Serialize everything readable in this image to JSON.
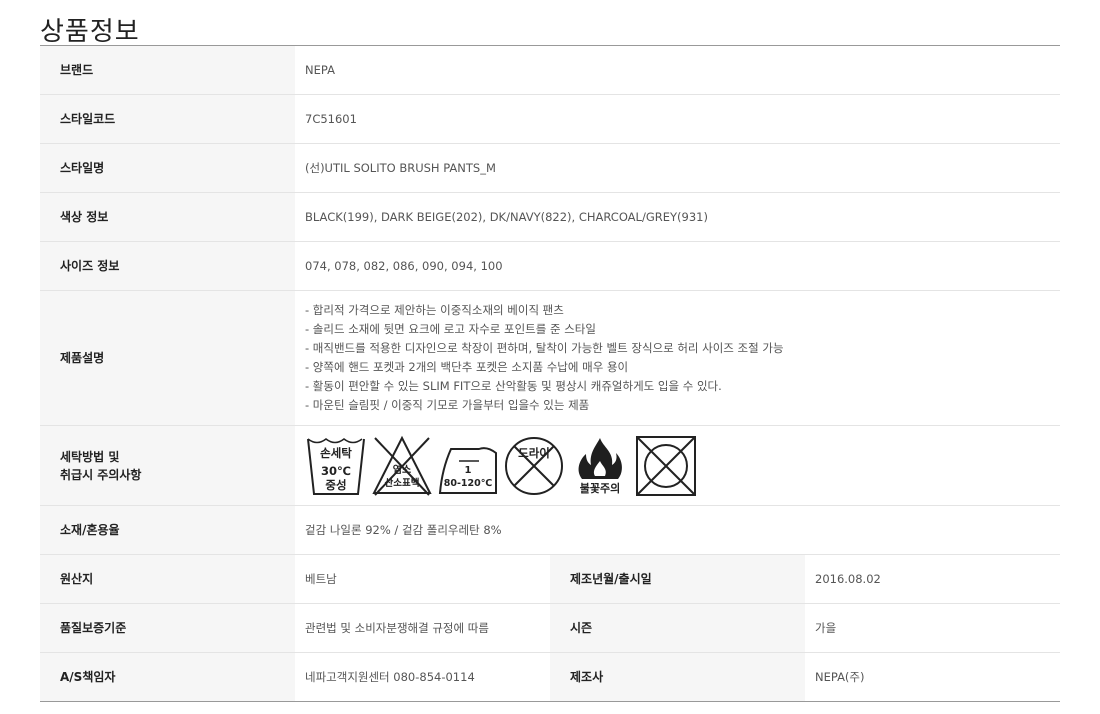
{
  "page": {
    "title": "상품정보"
  },
  "rows": {
    "brand": {
      "label": "브랜드",
      "value": "NEPA"
    },
    "style_code": {
      "label": "스타일코드",
      "value": "7C51601"
    },
    "style_name": {
      "label": "스타일명",
      "value": "(선)UTIL SOLITO BRUSH PANTS_M"
    },
    "color": {
      "label": "색상 정보",
      "value": "BLACK(199), DARK BEIGE(202), DK/NAVY(822), CHARCOAL/GREY(931)"
    },
    "size": {
      "label": "사이즈 정보",
      "value": "074, 078, 082, 086, 090, 094, 100"
    },
    "description": {
      "label": "제품설명",
      "lines": [
        "- 합리적 가격으로 제안하는 이중직소재의 베이직 팬츠",
        "- 솔리드 소재에 뒷면 요크에 로고 자수로 포인트를 준 스타일",
        "- 매직밴드를 적용한 디자인으로 착장이 편하며, 탈착이 가능한 벨트 장식으로 허리 사이즈 조절 가능",
        "- 양쪽에 핸드 포켓과 2개의 백단추 포켓은 소지품 수납에 매우 용이",
        "- 활동이 편안할 수 있는 SLIM FIT으로 산악활동 및 평상시 캐쥬얼하게도 입을 수 있다.",
        "- 마운틴 슬림핏 / 이중직 기모로 가을부터 입을수 있는 제품"
      ]
    },
    "care": {
      "label_line1": "세탁방법 및",
      "label_line2": "취급시 주의사항",
      "icons": {
        "handwash": {
          "name": "hand-wash-icon",
          "line1": "손세탁",
          "line2": "30℃",
          "line3": "중성"
        },
        "bleach": {
          "name": "no-bleach-icon",
          "line1": "염소",
          "line2": "산소표백"
        },
        "iron": {
          "name": "iron-icon",
          "line1": "1",
          "line2": "80-120℃"
        },
        "dryclean": {
          "name": "no-dry-clean-icon",
          "line1": "드라이"
        },
        "fire": {
          "name": "flammable-caution-icon",
          "line1": "불꽃주의"
        },
        "tumble": {
          "name": "no-tumble-dry-icon"
        }
      }
    },
    "material": {
      "label": "소재/혼용율",
      "value": "겉감 나일론 92% / 겉감 폴리우레탄 8%"
    },
    "origin": {
      "label": "원산지",
      "value": "베트남",
      "label2": "제조년월/출시일",
      "value2": "2016.08.02"
    },
    "quality": {
      "label": "품질보증기준",
      "value": "관련법 및 소비자분쟁해결 규정에 따름",
      "label2": "시즌",
      "value2": "가을"
    },
    "as": {
      "label": "A/S책임자",
      "value": "네파고객지원센터 080-854-0114",
      "label2": "제조사",
      "value2": "NEPA(주)"
    }
  }
}
